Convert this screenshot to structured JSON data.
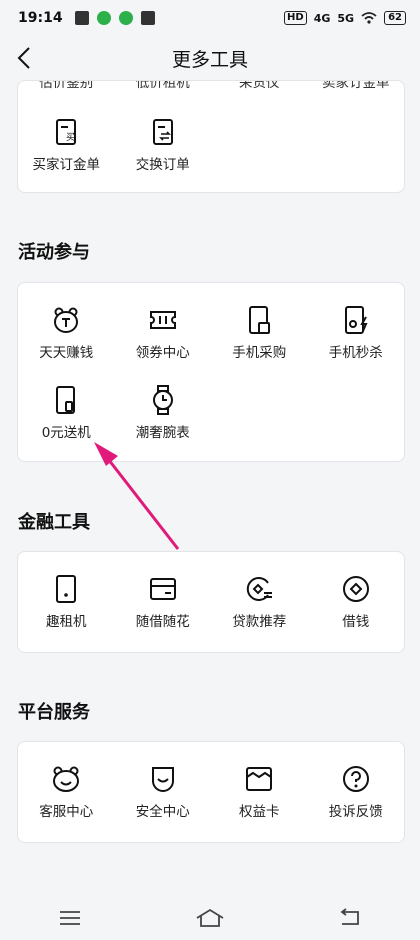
{
  "status_bar": {
    "time": "19:14",
    "hd": "HD",
    "net1": "4G",
    "net2": "5G",
    "battery": "62"
  },
  "nav": {
    "title": "更多工具"
  },
  "cut_section": {
    "cut_labels": [
      "估价鉴别",
      "低价租机",
      "采货仪",
      "卖家订金单"
    ],
    "items": [
      {
        "label": "买家订金单",
        "icon": "buyer-deposit-icon"
      },
      {
        "label": "交换订单",
        "icon": "exchange-order-icon"
      }
    ]
  },
  "activity": {
    "title": "活动参与",
    "items": [
      {
        "label": "天天赚钱",
        "icon": "bear-coin-icon"
      },
      {
        "label": "领券中心",
        "icon": "coupon-icon"
      },
      {
        "label": "手机采购",
        "icon": "phone-purchase-icon"
      },
      {
        "label": "手机秒杀",
        "icon": "phone-flash-sale-icon"
      },
      {
        "label": "0元送机",
        "icon": "free-phone-icon"
      },
      {
        "label": "潮奢腕表",
        "icon": "watch-icon"
      }
    ]
  },
  "finance": {
    "title": "金融工具",
    "items": [
      {
        "label": "趣租机",
        "icon": "rent-phone-icon"
      },
      {
        "label": "随借随花",
        "icon": "card-icon"
      },
      {
        "label": "贷款推荐",
        "icon": "loan-icon"
      },
      {
        "label": "借钱",
        "icon": "borrow-icon"
      }
    ]
  },
  "platform": {
    "title": "平台服务",
    "items": [
      {
        "label": "客服中心",
        "icon": "customer-service-icon"
      },
      {
        "label": "安全中心",
        "icon": "security-icon"
      },
      {
        "label": "权益卡",
        "icon": "benefit-card-icon"
      },
      {
        "label": "投诉反馈",
        "icon": "feedback-icon"
      }
    ]
  },
  "colors": {
    "accent_arrow": "#e0197a"
  }
}
